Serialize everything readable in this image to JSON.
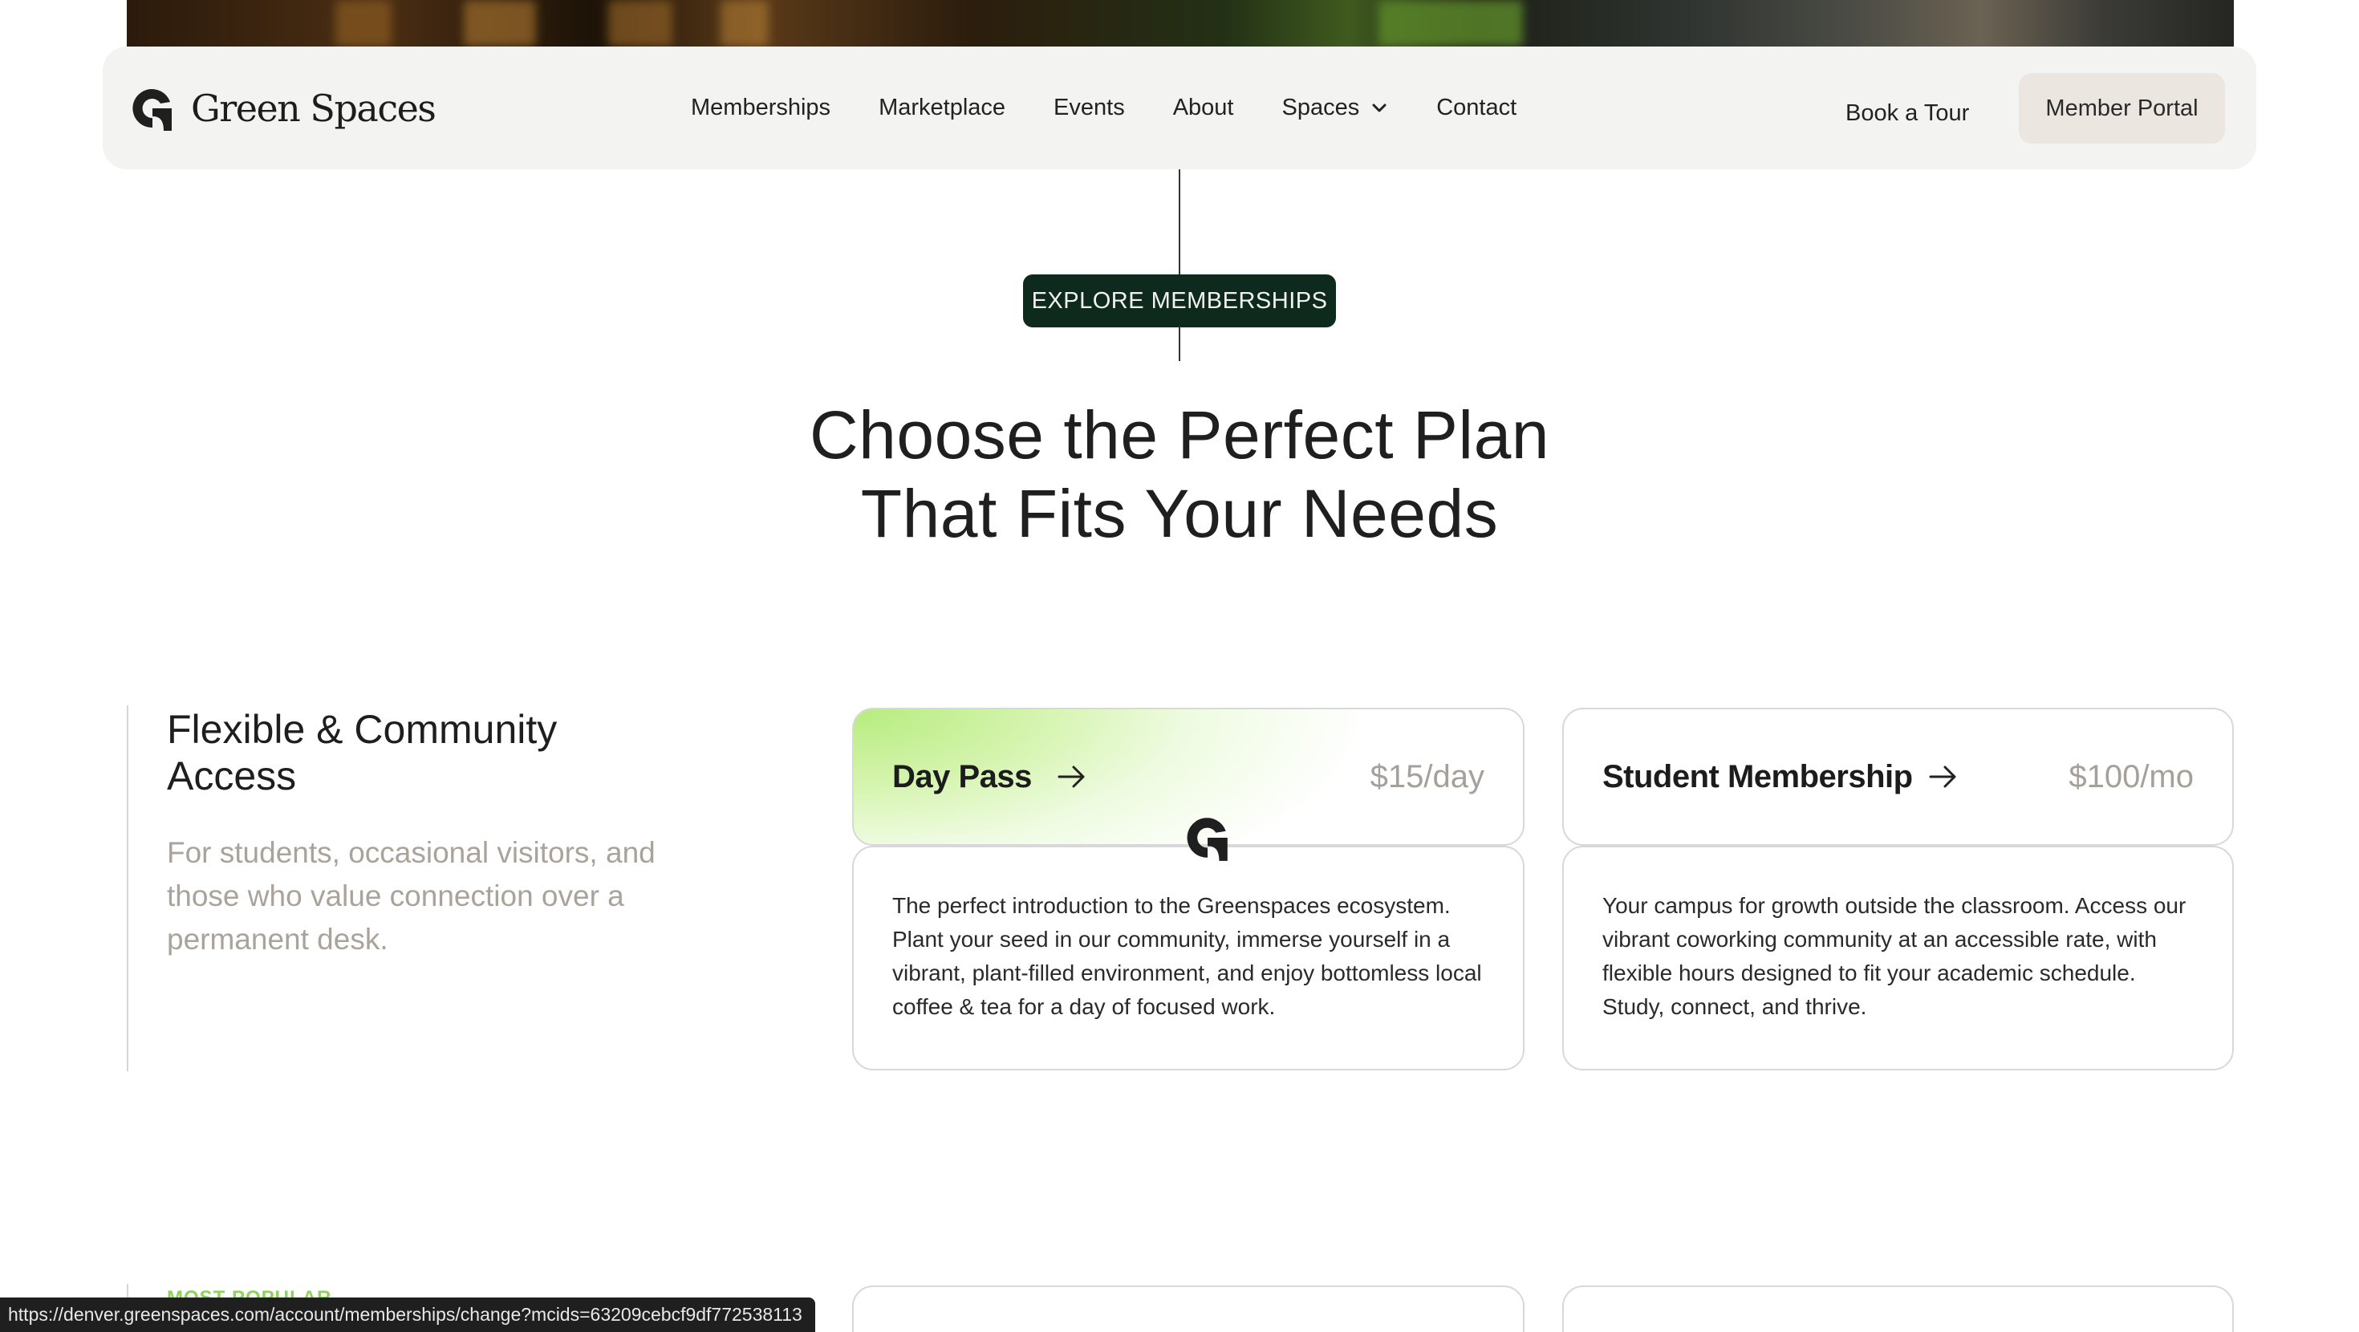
{
  "brand": {
    "name": "Green Spaces"
  },
  "nav": {
    "links": [
      "Memberships",
      "Marketplace",
      "Events",
      "About",
      "Spaces",
      "Contact"
    ],
    "book_tour": "Book a Tour",
    "member_portal": "Member Portal"
  },
  "section": {
    "eyebrow": "EXPLORE MEMBERSHIPS",
    "heading_line1": "Choose the Perfect Plan",
    "heading_line2": "That Fits Your Needs"
  },
  "category": {
    "title": "Flexible & Community Access",
    "description": "For students, occasional visitors, and those who value connection over a permanent desk."
  },
  "plans": [
    {
      "name": "Day Pass",
      "price": "$15/day",
      "description": "The perfect introduction to the Greenspaces ecosystem. Plant your seed in our community, immerse yourself in a vibrant, plant-filled environment, and enjoy bottomless local coffee & tea for a day of focused work."
    },
    {
      "name": "Student Membership",
      "price": "$100/mo",
      "description": "Your campus for growth outside the classroom. Access our vibrant coworking community at an accessible rate, with flexible hours designed to fit your academic schedule. Study, connect, and thrive."
    }
  ],
  "next_category": {
    "label": "MOST POPULAR"
  },
  "status_bar": {
    "url": "https://denver.greenspaces.com/account/memberships/change?mcids=63209cebcf9df772538113"
  },
  "colors": {
    "eyebrow_bg": "#0e2a1c",
    "featured_gradient": "#b6ec7e",
    "price_gray": "#a6a09a",
    "muted_text": "#a9a39b",
    "portal_bg": "#ece6e0"
  },
  "icons": [
    "logo-mark-icon",
    "chevron-down-icon",
    "arrow-right-icon"
  ]
}
